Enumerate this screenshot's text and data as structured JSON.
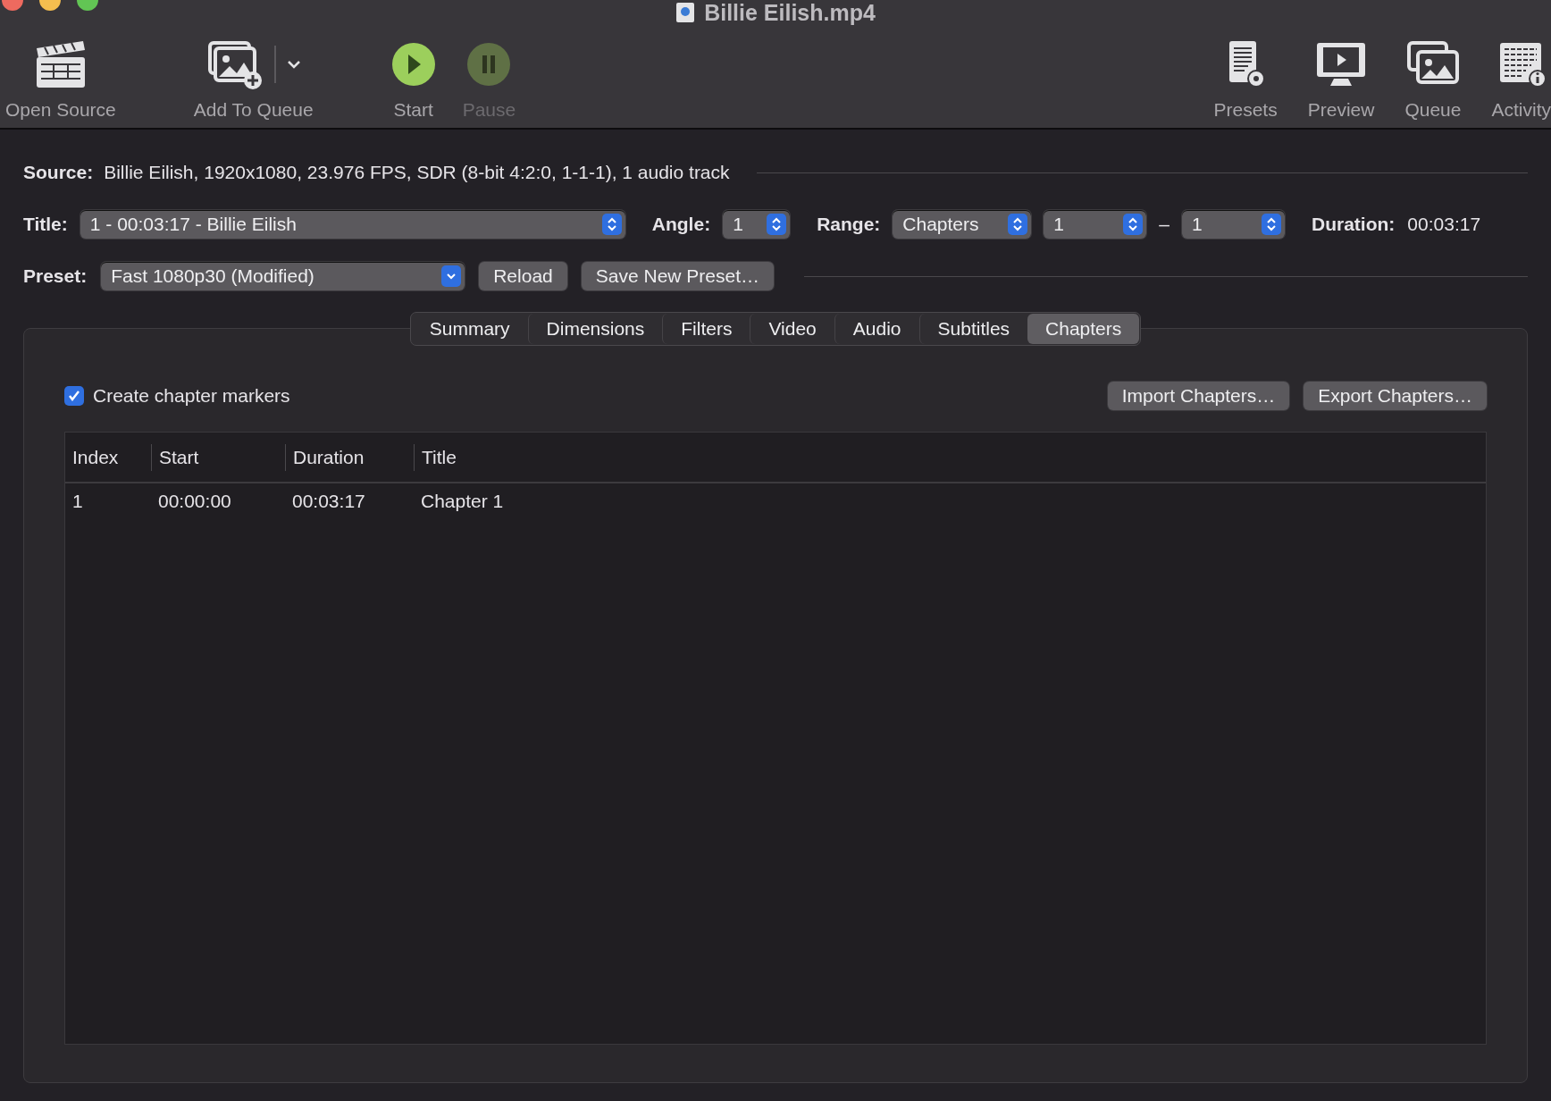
{
  "window": {
    "title": "Billie Eilish.mp4"
  },
  "toolbar": [
    {
      "kind": "open-source",
      "label": "Open Source",
      "disabled": false
    },
    {
      "kind": "add-queue",
      "label": "Add To Queue",
      "disabled": false
    },
    {
      "kind": "start",
      "label": "Start",
      "disabled": false
    },
    {
      "kind": "pause",
      "label": "Pause",
      "disabled": true
    },
    {
      "kind": "presets",
      "label": "Presets",
      "disabled": false
    },
    {
      "kind": "preview",
      "label": "Preview",
      "disabled": false
    },
    {
      "kind": "queue",
      "label": "Queue",
      "disabled": false
    },
    {
      "kind": "activity",
      "label": "Activity",
      "disabled": false
    }
  ],
  "source": {
    "label": "Source:",
    "value": "Billie Eilish, 1920x1080, 23.976 FPS, SDR (8-bit 4:2:0, 1-1-1), 1 audio track"
  },
  "title_select": {
    "label": "Title:",
    "value": "1 - 00:03:17 - Billie Eilish"
  },
  "angle": {
    "label": "Angle:",
    "value": "1"
  },
  "range": {
    "label": "Range:",
    "value": "Chapters",
    "from": "1",
    "separator": "–",
    "to": "1"
  },
  "duration": {
    "label": "Duration:",
    "value": "00:03:17"
  },
  "preset": {
    "label": "Preset:",
    "value": "Fast 1080p30 (Modified)"
  },
  "preset_buttons": [
    "Reload",
    "Save New Preset…"
  ],
  "tabs": [
    {
      "label": "Summary",
      "selected": false
    },
    {
      "label": "Dimensions",
      "selected": false
    },
    {
      "label": "Filters",
      "selected": false
    },
    {
      "label": "Video",
      "selected": false
    },
    {
      "label": "Audio",
      "selected": false
    },
    {
      "label": "Subtitles",
      "selected": false
    },
    {
      "label": "Chapters",
      "selected": true
    }
  ],
  "create_markers": {
    "label": "Create chapter markers",
    "checked": true
  },
  "chapter_buttons": [
    "Import Chapters…",
    "Export Chapters…"
  ],
  "table": {
    "columns": [
      "Index",
      "Start",
      "Duration",
      "Title"
    ],
    "rows": [
      [
        "1",
        "00:00:00",
        "00:03:17",
        "Chapter 1"
      ]
    ]
  }
}
